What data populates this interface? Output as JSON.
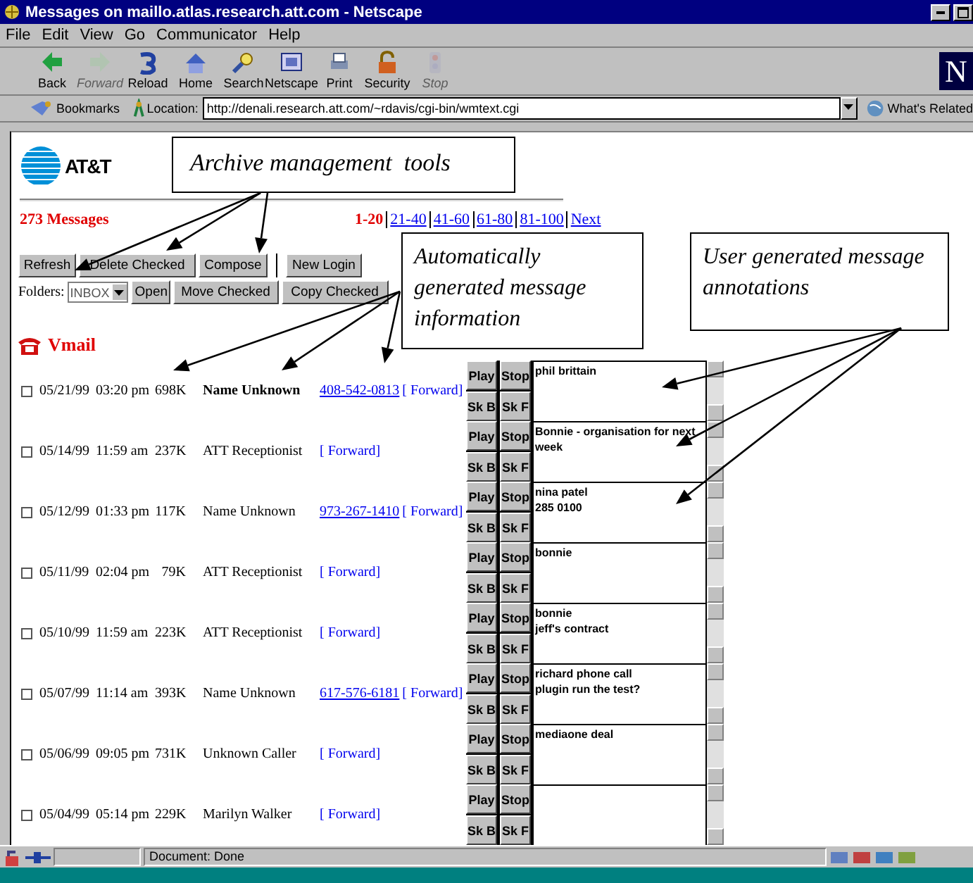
{
  "window": {
    "title": "Messages on maillo.atlas.research.att.com - Netscape"
  },
  "menu": [
    "File",
    "Edit",
    "View",
    "Go",
    "Communicator",
    "Help"
  ],
  "toolbar": [
    {
      "kind": "back",
      "label": "Back",
      "disabled": false
    },
    {
      "kind": "forward",
      "label": "Forward",
      "disabled": true
    },
    {
      "kind": "reload",
      "label": "Reload",
      "disabled": false
    },
    {
      "kind": "home",
      "label": "Home",
      "disabled": false
    },
    {
      "kind": "search",
      "label": "Search",
      "disabled": false
    },
    {
      "kind": "portal",
      "label": "Netscape",
      "disabled": false
    },
    {
      "kind": "print",
      "label": "Print",
      "disabled": false
    },
    {
      "kind": "security",
      "label": "Security",
      "disabled": false
    },
    {
      "kind": "stop",
      "label": "Stop",
      "disabled": true
    }
  ],
  "brand_mark": "N",
  "location_bar": {
    "bookmarks": "Bookmarks",
    "location_label": "Location:",
    "url": "http://denali.research.att.com/~rdavis/cgi-bin/wmtext.cgi",
    "related": "What's Related"
  },
  "page": {
    "logo_text": "AT&T",
    "message_count": "273 Messages",
    "pagination": [
      {
        "label": "1-20",
        "selected": true
      },
      {
        "label": "21-40",
        "selected": false
      },
      {
        "label": "41-60",
        "selected": false
      },
      {
        "label": "61-80",
        "selected": false
      },
      {
        "label": "81-100",
        "selected": false
      },
      {
        "label": "Next",
        "selected": false
      }
    ],
    "buttons": [
      "Refresh",
      "Delete Checked",
      "Compose",
      "New Login"
    ],
    "folders_label": "Folders:",
    "folder": "INBOX",
    "folder_buttons": [
      "Open",
      "Move Checked",
      "Copy Checked"
    ],
    "section_title": "Vmail",
    "messages": [
      {
        "checked": false,
        "unread": true,
        "date": "05/21/99",
        "time": "03:20 pm",
        "size": "698K",
        "caller": "Name Unknown",
        "phone": "408-542-0813",
        "forward": "[ Forward]",
        "controls": [
          "Play",
          "Stop",
          "Sk B",
          "Sk F"
        ],
        "note": "phil brittain"
      },
      {
        "checked": false,
        "unread": false,
        "date": "05/14/99",
        "time": "11:59 am",
        "size": "237K",
        "caller": "ATT Receptionist",
        "forward": "[ Forward]",
        "controls": [
          "Play",
          "Stop",
          "Sk B",
          "Sk F"
        ],
        "note": "Bonnie - organisation for next week"
      },
      {
        "checked": false,
        "unread": false,
        "date": "05/12/99",
        "time": "01:33 pm",
        "size": "117K",
        "caller": "Name Unknown",
        "phone": "973-267-1410",
        "forward": "[ Forward]",
        "controls": [
          "Play",
          "Stop",
          "Sk B",
          "Sk F"
        ],
        "note": "nina patel\n285 0100"
      },
      {
        "checked": false,
        "unread": false,
        "date": "05/11/99",
        "time": "02:04 pm",
        "size": "79K",
        "caller": "ATT Receptionist",
        "forward": "[ Forward]",
        "controls": [
          "Play",
          "Stop",
          "Sk B",
          "Sk F"
        ],
        "note": "bonnie"
      },
      {
        "checked": false,
        "unread": false,
        "date": "05/10/99",
        "time": "11:59 am",
        "size": "223K",
        "caller": "ATT Receptionist",
        "forward": "[ Forward]",
        "controls": [
          "Play",
          "Stop",
          "Sk B",
          "Sk F"
        ],
        "note": "bonnie\njeff's contract"
      },
      {
        "checked": false,
        "unread": false,
        "date": "05/07/99",
        "time": "11:14 am",
        "size": "393K",
        "caller": "Name Unknown",
        "phone": "617-576-6181",
        "forward": "[ Forward]",
        "controls": [
          "Play",
          "Stop",
          "Sk B",
          "Sk F"
        ],
        "note": "richard phone call\nplugin run the test?"
      },
      {
        "checked": false,
        "unread": false,
        "date": "05/06/99",
        "time": "09:05 pm",
        "size": "731K",
        "caller": "Unknown Caller",
        "forward": "[ Forward]",
        "controls": [
          "Play",
          "Stop",
          "Sk B",
          "Sk F"
        ],
        "note": "mediaone deal"
      },
      {
        "checked": false,
        "unread": false,
        "date": "05/04/99",
        "time": "05:14 pm",
        "size": "229K",
        "caller": "Marilyn Walker",
        "forward": "[ Forward]",
        "controls": [
          "Play",
          "Stop",
          "Sk B",
          "Sk F"
        ]
      }
    ]
  },
  "callouts": [
    {
      "text": "Archive management  tools"
    },
    {
      "text": "Automatically generated message information"
    },
    {
      "text": "User generated message annotations"
    }
  ],
  "status_bar": {
    "text": "Document: Done"
  }
}
